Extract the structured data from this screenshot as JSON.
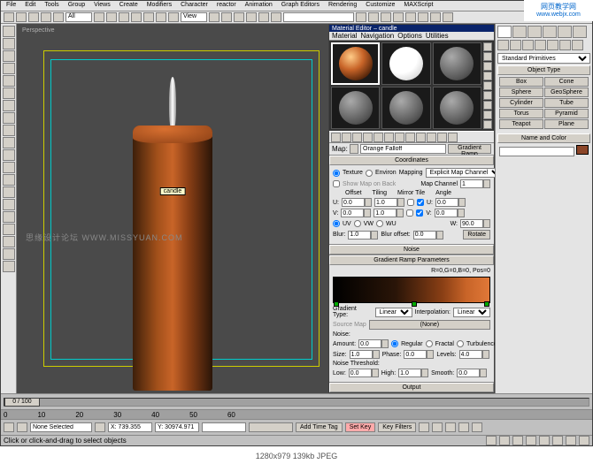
{
  "menubar": [
    "File",
    "Edit",
    "Tools",
    "Group",
    "Views",
    "Create",
    "Modifiers",
    "Character",
    "reactor",
    "Animation",
    "Graph Editors",
    "Rendering",
    "Customize",
    "MAXScript"
  ],
  "toolbar": {
    "dropdown_all": "All",
    "dropdown_view": "View"
  },
  "viewport": {
    "label": "Perspective",
    "tooltip": "candle",
    "watermark": "思缘设计论坛 WWW.MISSYUAN.COM"
  },
  "mat_editor": {
    "title": "Material Editor – candle",
    "menu": [
      "Material",
      "Navigation",
      "Options",
      "Utilities"
    ],
    "map_label": "Map:",
    "map_name": "Orange Falloff",
    "map_type": "Gradient Ramp",
    "coordinates": {
      "header": "Coordinates",
      "texture": "Texture",
      "environ": "Environ",
      "mapping_label": "Mapping",
      "mapping": "Explicit Map Channel",
      "show_map": "Show Map on Back",
      "map_channel_label": "Map Channel",
      "map_channel": "1",
      "offset_hdr": "Offset",
      "tiling_hdr": "Tiling",
      "mirror_hdr": "Mirror Tile",
      "angle_hdr": "Angle",
      "u": "U:",
      "v": "V:",
      "w": "W:",
      "u_offset": "0.0",
      "u_tiling": "1.0",
      "u_angle": "0.0",
      "v_offset": "0.0",
      "v_tiling": "1.0",
      "v_angle": "0.0",
      "w_angle": "90.0",
      "uv": "UV",
      "vw": "VW",
      "wu": "WU",
      "blur_label": "Blur:",
      "blur": "1.0",
      "blur_offset_label": "Blur offset:",
      "blur_offset": "0.0",
      "rotate": "Rotate"
    },
    "noise_header": "Noise",
    "gradient": {
      "header": "Gradient Ramp Parameters",
      "info": "R=0,G=0,B=0, Pos=0",
      "type_label": "Gradient Type:",
      "type": "Linear",
      "interp_label": "Interpolation:",
      "interp": "Linear",
      "source_map": "Source Map",
      "none": "(None)",
      "noise_hdr": "Noise:",
      "amount_label": "Amount:",
      "amount": "0.0",
      "regular": "Regular",
      "fractal": "Fractal",
      "turbulence": "Turbulence",
      "size_label": "Size:",
      "size": "1.0",
      "phase_label": "Phase:",
      "phase": "0.0",
      "levels_label": "Levels:",
      "levels": "4.0",
      "thresh_hdr": "Noise Threshold:",
      "low_label": "Low:",
      "low": "0.0",
      "high_label": "High:",
      "high": "1.0",
      "smooth_label": "Smooth:",
      "smooth": "0.0"
    },
    "output_header": "Output"
  },
  "cmd_panel": {
    "dropdown": "Standard Primitives",
    "obj_type_hdr": "Object Type",
    "buttons": [
      "Box",
      "Cone",
      "Sphere",
      "GeoSphere",
      "Cylinder",
      "Tube",
      "Torus",
      "Pyramid",
      "Teapot",
      "Plane"
    ],
    "name_hdr": "Name and Color"
  },
  "timeline": {
    "frame": "0 / 100",
    "ticks": [
      "0",
      "10",
      "20",
      "30",
      "40",
      "50",
      "60"
    ]
  },
  "status": {
    "none_selected": "None Selected",
    "x": "X: 739.355",
    "y": "Y: 30974.971",
    "z": "",
    "hint": "Click or click-and-drag to select objects",
    "add_tag": "Add Time Tag",
    "setkey": "Set Key",
    "keyfilters": "Key Filters"
  },
  "corner_wm": {
    "line1": "网页教学网",
    "line2": "www.webjx.com"
  },
  "footer": "1280x979  139kb  JPEG"
}
